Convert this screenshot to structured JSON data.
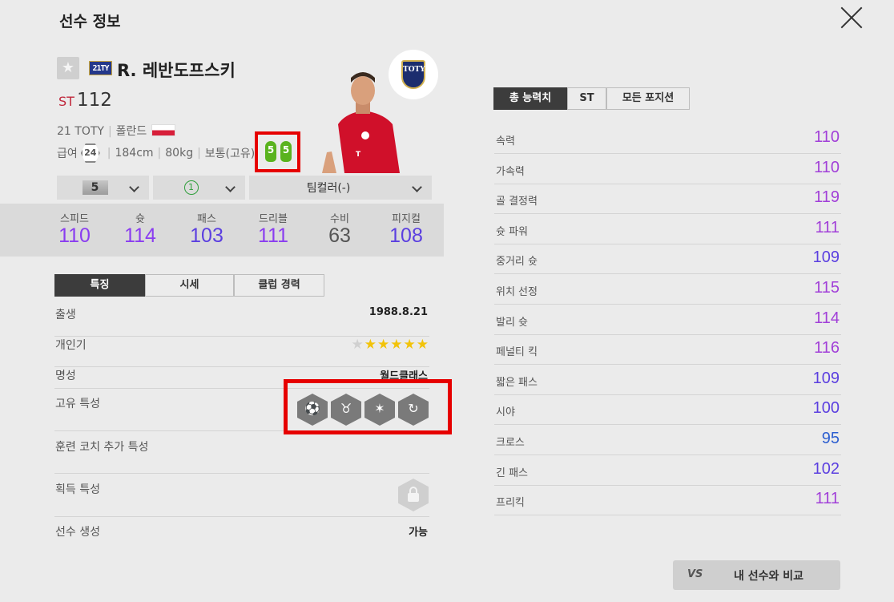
{
  "header": {
    "title": "선수 정보"
  },
  "player": {
    "season_badge": "21TY",
    "name": "R. 레반도프스키",
    "position": "ST",
    "overall": "112",
    "season": "21 TOTY",
    "nation": "폴란드",
    "salary_label": "급여",
    "salary": "24",
    "height": "184cm",
    "weight": "80kg",
    "body_type": "보통(고유)",
    "left_foot": "5",
    "right_foot": "5",
    "card_logo": "TOTY"
  },
  "selectors": {
    "grade": "5",
    "level": "1",
    "team_color": "팀컬러(-)"
  },
  "stats": [
    {
      "label": "스피드",
      "value": "110",
      "color": "#8a3df0"
    },
    {
      "label": "슛",
      "value": "114",
      "color": "#8a3df0"
    },
    {
      "label": "패스",
      "value": "103",
      "color": "#5b3fe0"
    },
    {
      "label": "드리블",
      "value": "111",
      "color": "#8a3df0"
    },
    {
      "label": "수비",
      "value": "63",
      "color": "#555555"
    },
    {
      "label": "피지컬",
      "value": "108",
      "color": "#5b3fe0"
    }
  ],
  "info_tabs": [
    "특징",
    "시세",
    "클럽 경력"
  ],
  "info": {
    "birth_label": "출생",
    "birth": "1988.8.21",
    "popularity_label": "개인기",
    "popularity_stars": 5,
    "reputation_label": "명성",
    "reputation": "월드클래스",
    "unique_traits_label": "고유 특성",
    "coach_traits_label": "훈련 코치 추가 특성",
    "acquired_traits_label": "획득 특성",
    "create_label": "선수 생성",
    "create": "가능"
  },
  "traits": [
    "goal-net-icon",
    "bull-icon",
    "speed-dribble-icon",
    "curl-shot-icon"
  ],
  "attr_tabs": [
    "총 능력치",
    "ST",
    "모든 포지션"
  ],
  "attributes": [
    {
      "label": "속력",
      "value": "110",
      "color": "#a13fd8"
    },
    {
      "label": "가속력",
      "value": "110",
      "color": "#a13fd8"
    },
    {
      "label": "골 결정력",
      "value": "119",
      "color": "#a13fd8"
    },
    {
      "label": "슛 파워",
      "value": "111",
      "color": "#a13fd8"
    },
    {
      "label": "중거리 슛",
      "value": "109",
      "color": "#5b3fe0"
    },
    {
      "label": "위치 선정",
      "value": "115",
      "color": "#a13fd8"
    },
    {
      "label": "발리 슛",
      "value": "114",
      "color": "#a13fd8"
    },
    {
      "label": "페널티 킥",
      "value": "116",
      "color": "#a13fd8"
    },
    {
      "label": "짧은 패스",
      "value": "109",
      "color": "#5b3fe0"
    },
    {
      "label": "시야",
      "value": "100",
      "color": "#5b3fe0"
    },
    {
      "label": "크로스",
      "value": "95",
      "color": "#2d5fd0"
    },
    {
      "label": "긴 패스",
      "value": "102",
      "color": "#5b3fe0"
    },
    {
      "label": "프리킥",
      "value": "111",
      "color": "#a13fd8"
    }
  ],
  "compare": {
    "icon": "VS",
    "label": "내 선수와 비교"
  }
}
